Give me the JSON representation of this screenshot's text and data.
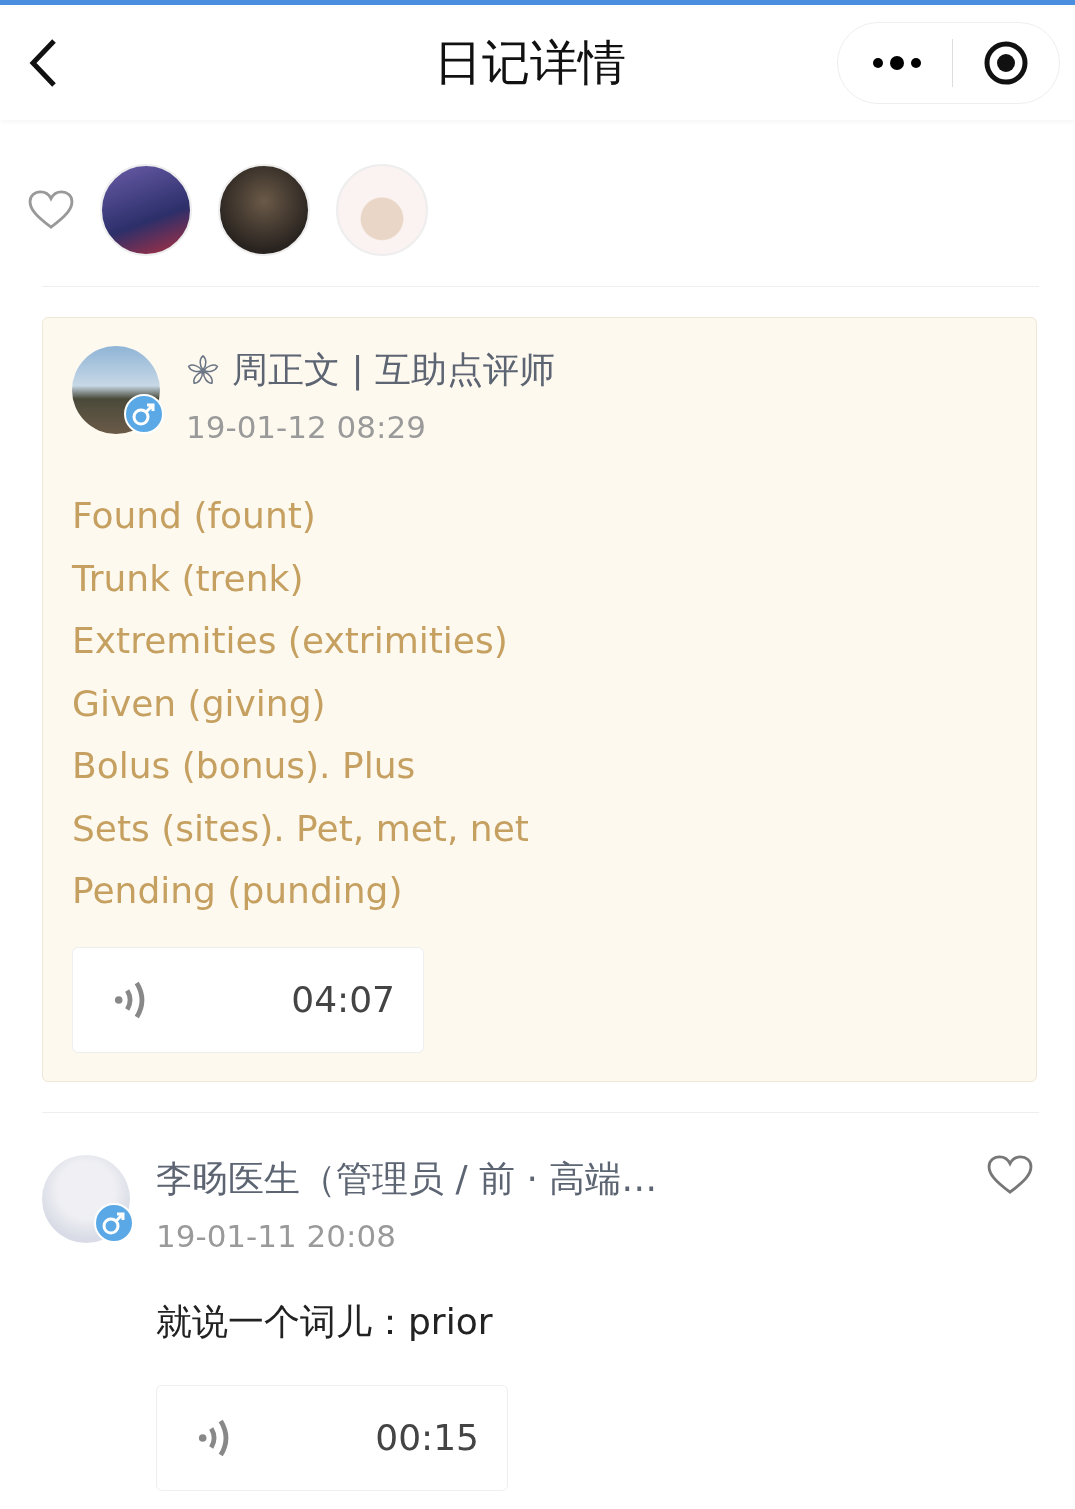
{
  "nav": {
    "title": "日记详情"
  },
  "likes": {
    "liked": false,
    "avatars": [
      {
        "kind": "photo"
      },
      {
        "kind": "photo"
      },
      {
        "kind": "cartoon"
      }
    ]
  },
  "post": {
    "author": "周正文 | 互助点评师",
    "male": true,
    "time": "19-01-12 08:29",
    "lines": [
      "Found (fount)",
      "Trunk (trenk)",
      "Extremities (extrimities)",
      "Given (giving)",
      "Bolus (bonus). Plus",
      "Sets (sites). Pet, met, net",
      "Pending (punding)"
    ],
    "voice": {
      "duration": "04:07"
    }
  },
  "comment": {
    "author": "李旸医生（管理员 / 前 · 高端…",
    "male": true,
    "time": "19-01-11 20:08",
    "liked": false,
    "text": "就说一个词儿：prior",
    "voice": {
      "duration": "00:15"
    }
  }
}
